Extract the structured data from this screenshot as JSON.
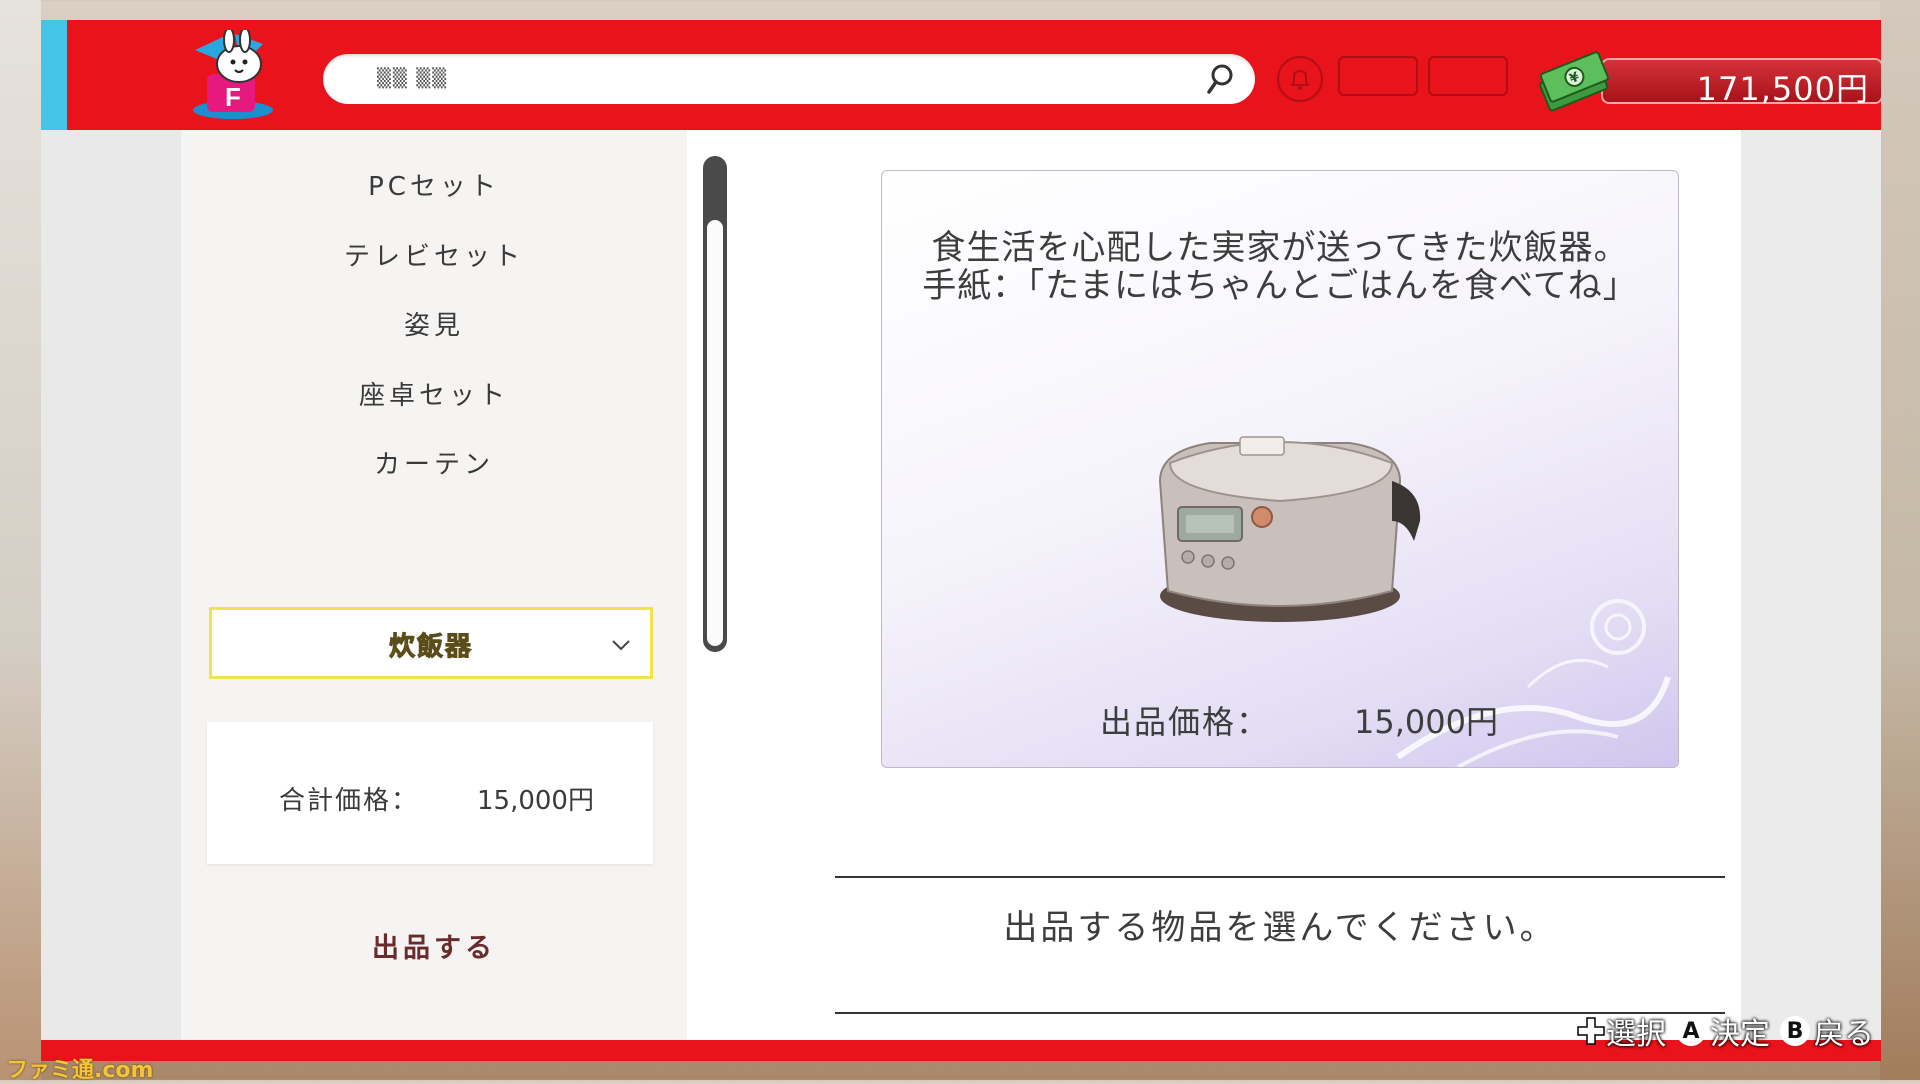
{
  "header": {
    "search_text": "▒▒ ▒▒",
    "money": "171,500円"
  },
  "sidebar": {
    "items": [
      {
        "label": "PCセット"
      },
      {
        "label": "テレビセット"
      },
      {
        "label": "姿見"
      },
      {
        "label": "座卓セット"
      },
      {
        "label": "カーテン"
      }
    ],
    "selected": {
      "label": "炊飯器"
    },
    "total_label": "合計価格：",
    "total_value": "15,000円",
    "submit_label": "出品する"
  },
  "item_card": {
    "description_line1": "食生活を心配した実家が送ってきた炊飯器。",
    "description_line2": "手紙：「たまにはちゃんとごはんを食べてね」",
    "price_label": "出品価格：",
    "price_value": "15,000円",
    "image_icon": "rice-cooker"
  },
  "instruction": "出品する物品を選んでください。",
  "controls": {
    "select": "選択",
    "confirm_button": "A",
    "confirm": "決定",
    "back_button": "B",
    "back": "戻る"
  },
  "watermark": "ファミ通.com",
  "colors": {
    "header_red": "#e8131b",
    "accent_blue": "#46c4e8",
    "highlight_yellow": "#f2e251"
  }
}
